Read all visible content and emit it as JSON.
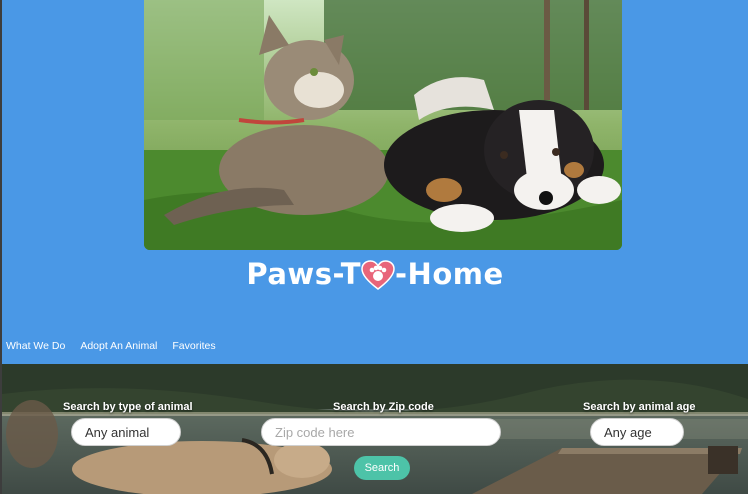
{
  "brand": {
    "logo_prefix": "Paws-T",
    "logo_suffix": "-Home"
  },
  "hero": {
    "image": "cat-and-puppy-photo"
  },
  "nav": {
    "items": [
      {
        "label": "What We Do"
      },
      {
        "label": "Adopt An Animal"
      },
      {
        "label": "Favorites"
      }
    ]
  },
  "search": {
    "type_label": "Search by type of animal",
    "type_value": "Any animal",
    "zip_label": "Search by Zip code",
    "zip_placeholder": "Zip code here",
    "age_label": "Search by animal age",
    "age_value": "Any age",
    "button_label": "Search",
    "background": "lake-dock-dog-photo"
  },
  "colors": {
    "header_bg": "#4a98e6",
    "button_bg": "#4dc3a8",
    "heart": "#e8657a"
  }
}
